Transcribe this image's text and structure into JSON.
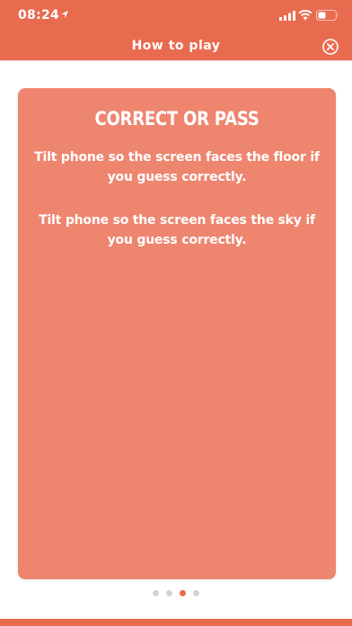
{
  "status_bar": {
    "time": "08:24"
  },
  "header": {
    "title": "How to play"
  },
  "card": {
    "title": "CORRECT OR PASS",
    "paragraph_1": "Tilt phone so the screen faces the floor if you guess correctly.",
    "paragraph_2": "Tilt phone so the screen faces the sky if you guess correctly."
  },
  "pager": {
    "page_count": 4,
    "current_page": 3
  },
  "colors": {
    "accent": "#e96b4f",
    "card": "#ee856f",
    "inactive_dot": "#d3d3d3"
  },
  "icons": [
    "location-arrow-icon",
    "signal-icon",
    "wifi-icon",
    "battery-icon",
    "close-icon"
  ]
}
